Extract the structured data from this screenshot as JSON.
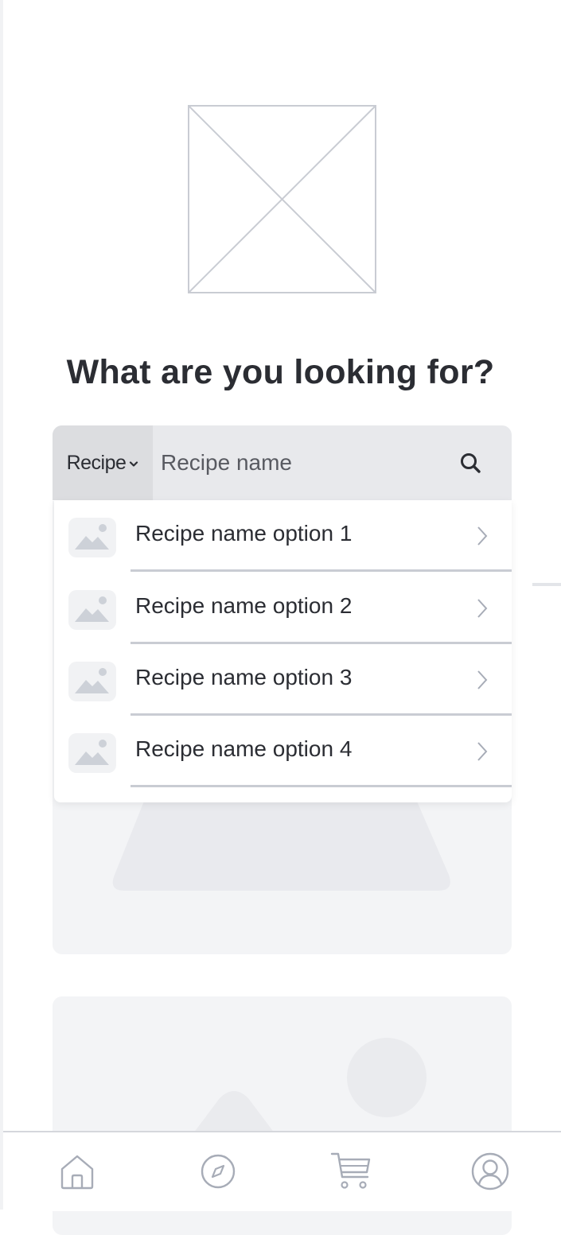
{
  "page": {
    "title": "What are you looking for?"
  },
  "hero": {
    "icon": "image-placeholder-icon"
  },
  "search": {
    "category_label": "Recipe",
    "placeholder": "Recipe name",
    "value": ""
  },
  "dropdown": {
    "items": [
      {
        "label": "Recipe name option 1",
        "icon": "image-icon"
      },
      {
        "label": "Recipe name option 2",
        "icon": "image-icon"
      },
      {
        "label": "Recipe name option 3",
        "icon": "image-icon"
      },
      {
        "label": "Recipe name option 4",
        "icon": "image-icon"
      }
    ]
  },
  "tabbar": {
    "tabs": [
      {
        "icon": "home-icon"
      },
      {
        "icon": "compass-icon"
      },
      {
        "icon": "cart-icon"
      },
      {
        "icon": "profile-icon"
      }
    ]
  },
  "colors": {
    "text": "#2b2d33",
    "search_bg": "#e8e9ec",
    "select_bg": "#dcdde0",
    "placeholder_card": "#f3f4f6",
    "divider": "#c9ccd3",
    "icon_gray": "#a7acb7"
  }
}
